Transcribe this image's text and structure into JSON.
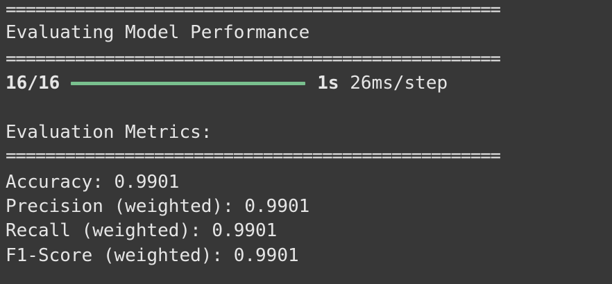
{
  "separator": "==================================================",
  "header": {
    "title": "Evaluating Model Performance"
  },
  "progress": {
    "counter": "16/16",
    "fraction": 1.0,
    "elapsed": "1s",
    "rate": "26ms/step",
    "bar_color": "#79c08e"
  },
  "metrics": {
    "heading": "Evaluation Metrics:",
    "accuracy": "Accuracy: 0.9901",
    "precision": "Precision (weighted): 0.9901",
    "recall": "Recall (weighted): 0.9901",
    "f1": "F1-Score (weighted): 0.9901"
  },
  "colors": {
    "background": "#373737",
    "text": "#e6e6e6"
  }
}
